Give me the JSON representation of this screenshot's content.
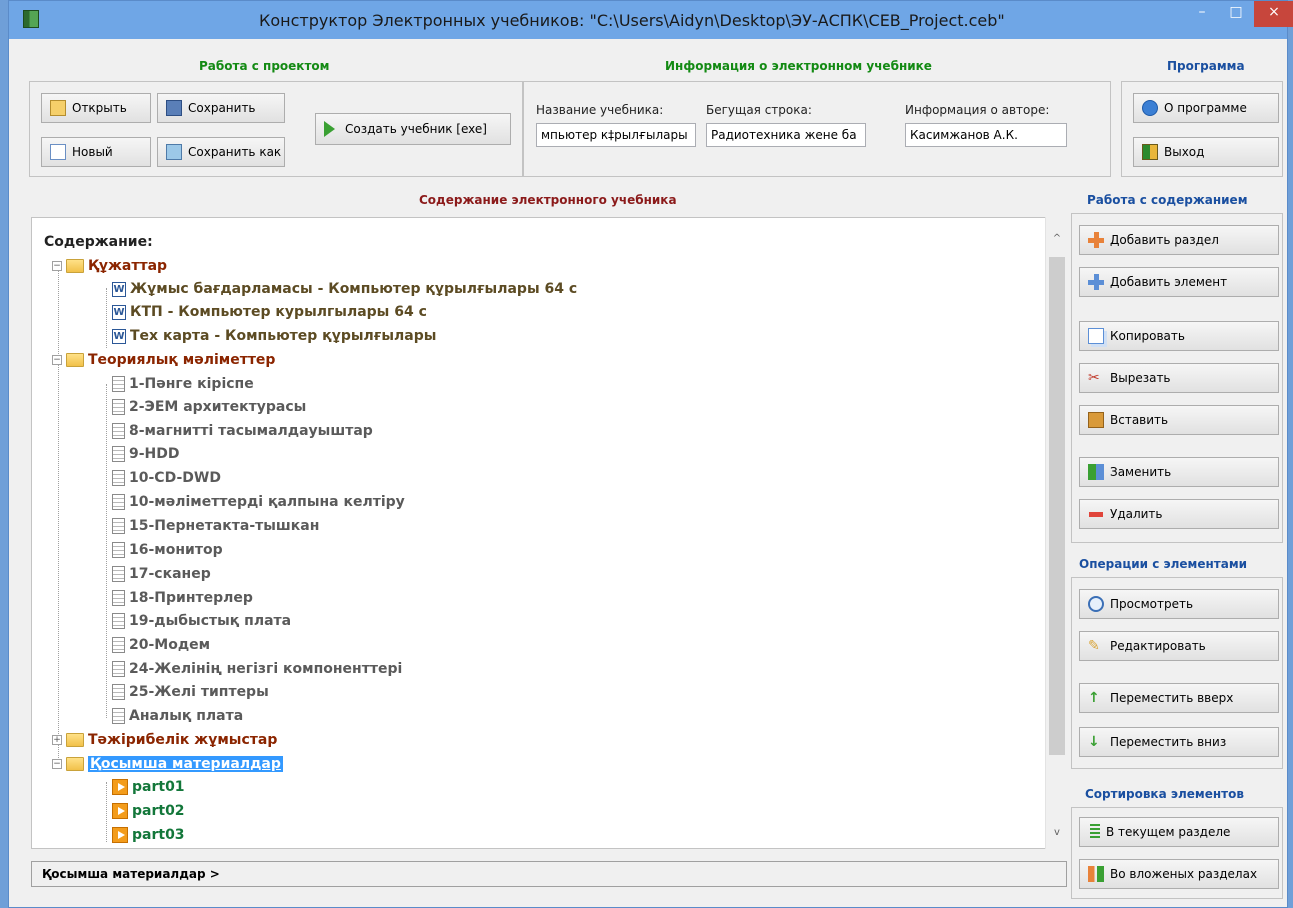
{
  "window": {
    "title": "Конструктор Электронных учебников: \"C:\\Users\\Aidyn\\Desktop\\ЭУ-АСПК\\CEB_Project.ceb\"",
    "minimize": "–",
    "maximize": "□",
    "close": "×"
  },
  "project": {
    "group_title": "Работа с проектом",
    "open": "Открыть",
    "save": "Сохранить",
    "new": "Новый",
    "save_as": "Сохранить как",
    "build": "Создать учебник [exe]"
  },
  "info": {
    "group_title": "Информация о электронном учебнике",
    "title_label": "Название учебника:",
    "title_value": "мпьютер к‡рылғылары",
    "ticker_label": "Бегущая строка:",
    "ticker_value": "Радиотехника жене ба",
    "author_label": "Информация о авторе:",
    "author_value": "Касимжанов А.К."
  },
  "program": {
    "group_title": "Программа",
    "about": "О программе",
    "exit": "Выход"
  },
  "content": {
    "group_title": "Содержание электронного учебника",
    "tree_header": "Содержание:",
    "folders": [
      {
        "label": "Құжаттар",
        "expander": "−"
      },
      {
        "label": "Теориялық мәліметтер",
        "expander": "−"
      },
      {
        "label": "Тәжірибелік жұмыстар",
        "expander": "+"
      },
      {
        "label": "Қосымша материалдар",
        "expander": "−"
      }
    ],
    "word_docs": [
      "Жұмыс бағдарламасы - Компьютер құрылғылары 64 с",
      "КТП - Компьютер курылгылары 64 с",
      "Тех карта - Компьютер құрылғылары"
    ],
    "theory_items": [
      "1-Пәнге кіріспе",
      "2-ЭЕМ архитектурасы",
      "8-магнитті тасымалдауыштар",
      "9-HDD",
      "10-CD-DWD",
      "10-мәліметтерді қалпына келтіру",
      "15-Пернетакта-тышкан",
      "16-монитор",
      "17-сканер",
      "18-Принтерлер",
      "19-дыбыстық плата",
      "20-Модем",
      "24-Желінің негізгі компоненттері",
      "25-Желі типтеры",
      "Аналық плата"
    ],
    "parts": [
      "part01",
      "part02",
      "part03"
    ],
    "word_badge": "W",
    "scroll_up": "^",
    "scroll_down": "v",
    "status_path": "Қосымша материалдар >"
  },
  "content_ops": {
    "group_title": "Работа с содержанием",
    "add_section": "Добавить раздел",
    "add_element": "Добавить элемент",
    "copy": "Копировать",
    "cut": "Вырезать",
    "paste": "Вставить",
    "replace": "Заменить",
    "delete": "Удалить"
  },
  "element_ops": {
    "group_title": "Операции с элементами",
    "view": "Просмотреть",
    "edit": "Редактировать",
    "move_up": "Переместить вверх",
    "move_down": "Переместить вниз"
  },
  "sort": {
    "group_title": "Сортировка элементов",
    "current": "В текущем разделе",
    "nested": "Во вложеных разделах"
  },
  "colors": {
    "group_green": "#138a13",
    "group_blue": "#1a4fa0",
    "group_red": "#8b1a1a",
    "selection": "#3399ff",
    "close_red": "#c7463c"
  }
}
